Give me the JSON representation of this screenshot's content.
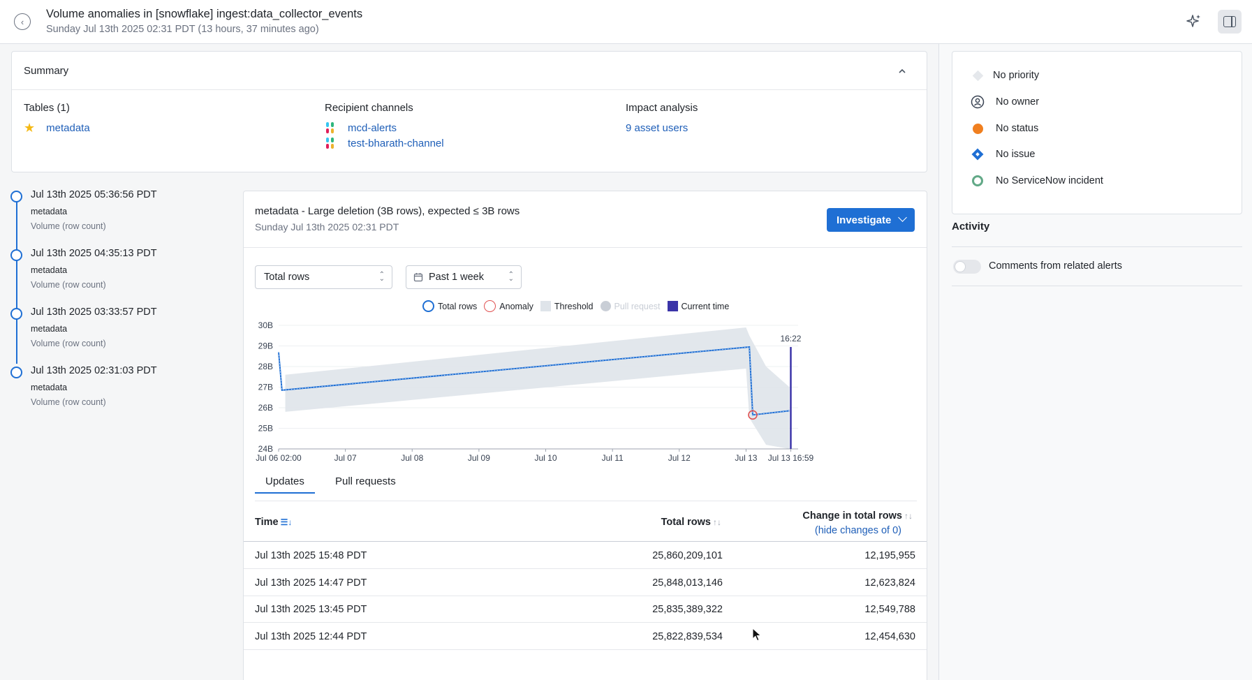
{
  "header": {
    "title": "Volume anomalies in [snowflake] ingest:data_collector_events",
    "subtitle": "Sunday Jul 13th 2025 02:31 PDT (13 hours, 37 minutes ago)"
  },
  "summary": {
    "title": "Summary",
    "tables_heading": "Tables (1)",
    "table_name": "metadata",
    "recipients_heading": "Recipient channels",
    "channels": [
      "mcd-alerts",
      "test-bharath-channel"
    ],
    "impact_heading": "Impact analysis",
    "impact_link": "9 asset users"
  },
  "timeline": [
    {
      "time": "Jul 13th 2025 05:36:56 PDT",
      "table": "metadata",
      "kind": "Volume (row count)"
    },
    {
      "time": "Jul 13th 2025 04:35:13 PDT",
      "table": "metadata",
      "kind": "Volume (row count)"
    },
    {
      "time": "Jul 13th 2025 03:33:57 PDT",
      "table": "metadata",
      "kind": "Volume (row count)"
    },
    {
      "time": "Jul 13th 2025 02:31:03 PDT",
      "table": "metadata",
      "kind": "Volume (row count)"
    }
  ],
  "card": {
    "title": "metadata  -  Large deletion (3B rows), expected ≤ 3B rows",
    "subtitle": "Sunday Jul 13th 2025 02:31 PDT",
    "investigate": "Investigate",
    "metric_select": "Total rows",
    "range_select": "Past 1 week",
    "legend": [
      "Total rows",
      "Anomaly",
      "Threshold",
      "Pull request",
      "Current time"
    ],
    "tabs": [
      "Updates",
      "Pull requests"
    ],
    "table": {
      "col_time": "Time",
      "col_total": "Total rows",
      "col_change": "Change in total rows",
      "hide_link": "(hide changes of 0)",
      "rows": [
        {
          "time": "Jul 13th 2025 15:48 PDT",
          "total": "25,860,209,101",
          "change": "12,195,955"
        },
        {
          "time": "Jul 13th 2025 14:47 PDT",
          "total": "25,848,013,146",
          "change": "12,623,824"
        },
        {
          "time": "Jul 13th 2025 13:45 PDT",
          "total": "25,835,389,322",
          "change": "12,549,788"
        },
        {
          "time": "Jul 13th 2025 12:44 PDT",
          "total": "25,822,839,534",
          "change": "12,454,630"
        }
      ]
    }
  },
  "chart_data": {
    "type": "line",
    "y_ticks": [
      "30B",
      "29B",
      "28B",
      "27B",
      "26B",
      "25B",
      "24B"
    ],
    "x_ticks": [
      "Jul 06 02:00",
      "Jul 07",
      "Jul 08",
      "Jul 09",
      "Jul 10",
      "Jul 11",
      "Jul 12",
      "Jul 13",
      "Jul 13 16:59"
    ],
    "ylim": [
      24,
      30
    ],
    "y_unit": "B rows",
    "current_time_label": "16:22",
    "series": [
      {
        "name": "Total rows",
        "points": [
          [
            0,
            28.7
          ],
          [
            0.05,
            26.85
          ],
          [
            7.05,
            28.95
          ],
          [
            7.1,
            25.65
          ],
          [
            7.65,
            25.85
          ]
        ]
      }
    ],
    "anomaly": {
      "x": 7.1,
      "y": 25.65
    },
    "threshold_band": [
      [
        0.1,
        25.8,
        27.6
      ],
      [
        7.0,
        27.9,
        29.9
      ],
      [
        7.05,
        25.5,
        29.5
      ],
      [
        7.3,
        24.2,
        28.0
      ],
      [
        7.65,
        24.0,
        27.0
      ]
    ],
    "current_time_x": 7.67,
    "colors": {
      "line": "#1f6fd4",
      "anomaly": "#e05252",
      "threshold": "#dfe4ea",
      "current": "#3b34a8"
    }
  },
  "side": {
    "priority": "No priority",
    "owner": "No owner",
    "status": "No status",
    "issue": "No issue",
    "servicenow": "No ServiceNow incident",
    "activity_title": "Activity",
    "toggle_label": "Comments from related alerts"
  }
}
